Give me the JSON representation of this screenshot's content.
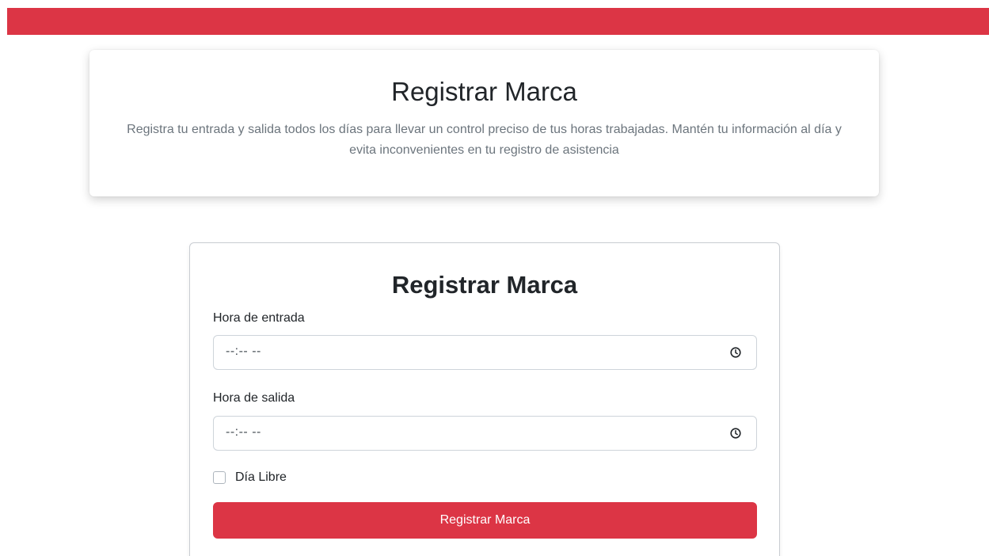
{
  "header": {
    "title": "Registrar Marca",
    "description": "Registra tu entrada y salida todos los días para llevar un control preciso de tus horas trabajadas. Mantén tu información al día y evita inconvenientes en tu registro de asistencia"
  },
  "form": {
    "title": "Registrar Marca",
    "entry_label": "Hora de entrada",
    "entry_value": "--:-- --",
    "exit_label": "Hora de salida",
    "exit_value": "--:-- --",
    "day_off_label": "Día Libre",
    "day_off_checked": false,
    "submit_label": "Registrar Marca"
  },
  "icons": {
    "time_picker": "clock-icon"
  },
  "colors": {
    "accent": "#dc3545",
    "muted_text": "#6c757d",
    "border": "#ced4da"
  }
}
